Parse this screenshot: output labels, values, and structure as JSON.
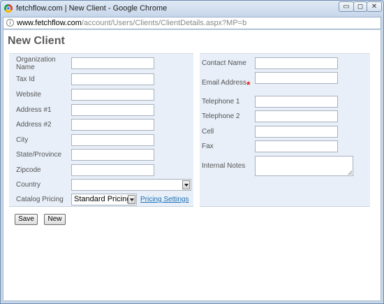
{
  "window": {
    "title": "fetchflow.com | New Client - Google Chrome",
    "controls": {
      "minimize": "▭",
      "maximize": "◻",
      "close": "✕"
    }
  },
  "address_bar": {
    "host": "www.fetchflow.com",
    "path": "/account/Users/Clients/ClientDetails.aspx?MP=b"
  },
  "page": {
    "title": "New Client"
  },
  "left_form": {
    "organization_name_label": "Organization Name",
    "tax_id_label": "Tax Id",
    "website_label": "Website",
    "address1_label": "Address #1",
    "address2_label": "Address #2",
    "city_label": "City",
    "state_label": "State/Province",
    "zipcode_label": "Zipcode",
    "country_label": "Country",
    "country_value": "",
    "catalog_pricing_label": "Catalog Pricing",
    "catalog_pricing_value": "Standard Pricing",
    "pricing_settings_link": "Pricing Settings"
  },
  "right_form": {
    "contact_name_label": "Contact Name",
    "email_label": "Email Address",
    "required_marker": "*",
    "telephone1_label": "Telephone 1",
    "telephone2_label": "Telephone 2",
    "cell_label": "Cell",
    "fax_label": "Fax",
    "internal_notes_label": "Internal Notes"
  },
  "buttons": {
    "save": "Save",
    "new": "New"
  },
  "colors": {
    "required": "#e02020",
    "link": "#1c6fb5",
    "panel_bg": "#e8eff8"
  }
}
